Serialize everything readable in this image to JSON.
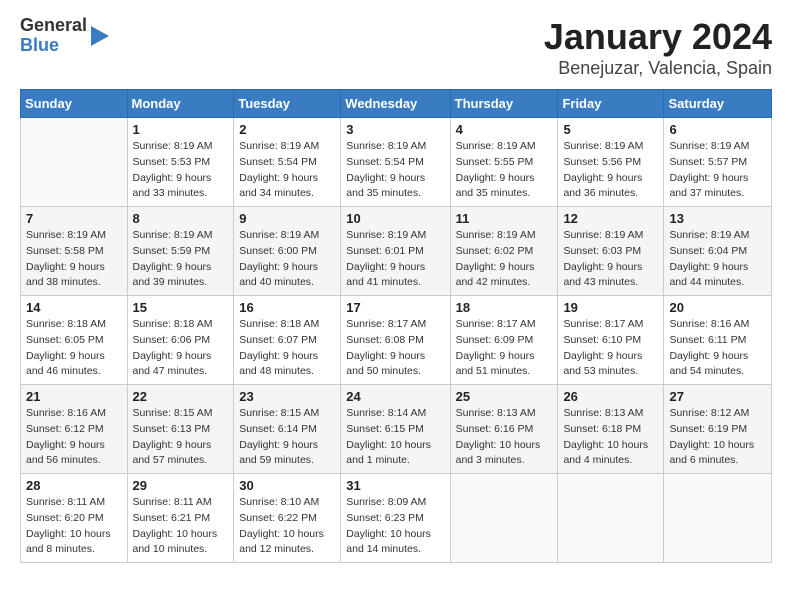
{
  "logo": {
    "general": "General",
    "blue": "Blue"
  },
  "title": "January 2024",
  "subtitle": "Benejuzar, Valencia, Spain",
  "weekdays": [
    "Sunday",
    "Monday",
    "Tuesday",
    "Wednesday",
    "Thursday",
    "Friday",
    "Saturday"
  ],
  "weeks": [
    [
      {
        "day": "",
        "sunrise": "",
        "sunset": "",
        "daylight": ""
      },
      {
        "day": "1",
        "sunrise": "Sunrise: 8:19 AM",
        "sunset": "Sunset: 5:53 PM",
        "daylight": "Daylight: 9 hours and 33 minutes."
      },
      {
        "day": "2",
        "sunrise": "Sunrise: 8:19 AM",
        "sunset": "Sunset: 5:54 PM",
        "daylight": "Daylight: 9 hours and 34 minutes."
      },
      {
        "day": "3",
        "sunrise": "Sunrise: 8:19 AM",
        "sunset": "Sunset: 5:54 PM",
        "daylight": "Daylight: 9 hours and 35 minutes."
      },
      {
        "day": "4",
        "sunrise": "Sunrise: 8:19 AM",
        "sunset": "Sunset: 5:55 PM",
        "daylight": "Daylight: 9 hours and 35 minutes."
      },
      {
        "day": "5",
        "sunrise": "Sunrise: 8:19 AM",
        "sunset": "Sunset: 5:56 PM",
        "daylight": "Daylight: 9 hours and 36 minutes."
      },
      {
        "day": "6",
        "sunrise": "Sunrise: 8:19 AM",
        "sunset": "Sunset: 5:57 PM",
        "daylight": "Daylight: 9 hours and 37 minutes."
      }
    ],
    [
      {
        "day": "7",
        "sunrise": "Sunrise: 8:19 AM",
        "sunset": "Sunset: 5:58 PM",
        "daylight": "Daylight: 9 hours and 38 minutes."
      },
      {
        "day": "8",
        "sunrise": "Sunrise: 8:19 AM",
        "sunset": "Sunset: 5:59 PM",
        "daylight": "Daylight: 9 hours and 39 minutes."
      },
      {
        "day": "9",
        "sunrise": "Sunrise: 8:19 AM",
        "sunset": "Sunset: 6:00 PM",
        "daylight": "Daylight: 9 hours and 40 minutes."
      },
      {
        "day": "10",
        "sunrise": "Sunrise: 8:19 AM",
        "sunset": "Sunset: 6:01 PM",
        "daylight": "Daylight: 9 hours and 41 minutes."
      },
      {
        "day": "11",
        "sunrise": "Sunrise: 8:19 AM",
        "sunset": "Sunset: 6:02 PM",
        "daylight": "Daylight: 9 hours and 42 minutes."
      },
      {
        "day": "12",
        "sunrise": "Sunrise: 8:19 AM",
        "sunset": "Sunset: 6:03 PM",
        "daylight": "Daylight: 9 hours and 43 minutes."
      },
      {
        "day": "13",
        "sunrise": "Sunrise: 8:19 AM",
        "sunset": "Sunset: 6:04 PM",
        "daylight": "Daylight: 9 hours and 44 minutes."
      }
    ],
    [
      {
        "day": "14",
        "sunrise": "Sunrise: 8:18 AM",
        "sunset": "Sunset: 6:05 PM",
        "daylight": "Daylight: 9 hours and 46 minutes."
      },
      {
        "day": "15",
        "sunrise": "Sunrise: 8:18 AM",
        "sunset": "Sunset: 6:06 PM",
        "daylight": "Daylight: 9 hours and 47 minutes."
      },
      {
        "day": "16",
        "sunrise": "Sunrise: 8:18 AM",
        "sunset": "Sunset: 6:07 PM",
        "daylight": "Daylight: 9 hours and 48 minutes."
      },
      {
        "day": "17",
        "sunrise": "Sunrise: 8:17 AM",
        "sunset": "Sunset: 6:08 PM",
        "daylight": "Daylight: 9 hours and 50 minutes."
      },
      {
        "day": "18",
        "sunrise": "Sunrise: 8:17 AM",
        "sunset": "Sunset: 6:09 PM",
        "daylight": "Daylight: 9 hours and 51 minutes."
      },
      {
        "day": "19",
        "sunrise": "Sunrise: 8:17 AM",
        "sunset": "Sunset: 6:10 PM",
        "daylight": "Daylight: 9 hours and 53 minutes."
      },
      {
        "day": "20",
        "sunrise": "Sunrise: 8:16 AM",
        "sunset": "Sunset: 6:11 PM",
        "daylight": "Daylight: 9 hours and 54 minutes."
      }
    ],
    [
      {
        "day": "21",
        "sunrise": "Sunrise: 8:16 AM",
        "sunset": "Sunset: 6:12 PM",
        "daylight": "Daylight: 9 hours and 56 minutes."
      },
      {
        "day": "22",
        "sunrise": "Sunrise: 8:15 AM",
        "sunset": "Sunset: 6:13 PM",
        "daylight": "Daylight: 9 hours and 57 minutes."
      },
      {
        "day": "23",
        "sunrise": "Sunrise: 8:15 AM",
        "sunset": "Sunset: 6:14 PM",
        "daylight": "Daylight: 9 hours and 59 minutes."
      },
      {
        "day": "24",
        "sunrise": "Sunrise: 8:14 AM",
        "sunset": "Sunset: 6:15 PM",
        "daylight": "Daylight: 10 hours and 1 minute."
      },
      {
        "day": "25",
        "sunrise": "Sunrise: 8:13 AM",
        "sunset": "Sunset: 6:16 PM",
        "daylight": "Daylight: 10 hours and 3 minutes."
      },
      {
        "day": "26",
        "sunrise": "Sunrise: 8:13 AM",
        "sunset": "Sunset: 6:18 PM",
        "daylight": "Daylight: 10 hours and 4 minutes."
      },
      {
        "day": "27",
        "sunrise": "Sunrise: 8:12 AM",
        "sunset": "Sunset: 6:19 PM",
        "daylight": "Daylight: 10 hours and 6 minutes."
      }
    ],
    [
      {
        "day": "28",
        "sunrise": "Sunrise: 8:11 AM",
        "sunset": "Sunset: 6:20 PM",
        "daylight": "Daylight: 10 hours and 8 minutes."
      },
      {
        "day": "29",
        "sunrise": "Sunrise: 8:11 AM",
        "sunset": "Sunset: 6:21 PM",
        "daylight": "Daylight: 10 hours and 10 minutes."
      },
      {
        "day": "30",
        "sunrise": "Sunrise: 8:10 AM",
        "sunset": "Sunset: 6:22 PM",
        "daylight": "Daylight: 10 hours and 12 minutes."
      },
      {
        "day": "31",
        "sunrise": "Sunrise: 8:09 AM",
        "sunset": "Sunset: 6:23 PM",
        "daylight": "Daylight: 10 hours and 14 minutes."
      },
      {
        "day": "",
        "sunrise": "",
        "sunset": "",
        "daylight": ""
      },
      {
        "day": "",
        "sunrise": "",
        "sunset": "",
        "daylight": ""
      },
      {
        "day": "",
        "sunrise": "",
        "sunset": "",
        "daylight": ""
      }
    ]
  ]
}
